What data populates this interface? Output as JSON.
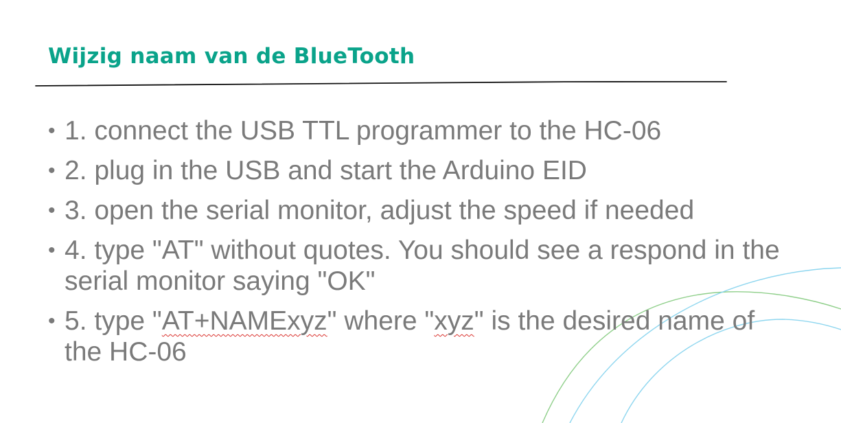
{
  "title": "Wijzig naam van de BlueTooth",
  "bullet_symbol": "•",
  "steps": [
    {
      "text": "1. connect the USB TTL programmer to the HC-06"
    },
    {
      "text": "2. plug in the USB and start the Arduino EID"
    },
    {
      "text": "3. open the serial monitor, adjust the speed if needed"
    },
    {
      "text": "4. type \"AT\" without quotes. You should see a respond in the serial monitor saying \"OK\""
    },
    {
      "p1": "5. type \"",
      "p2": "AT+NAMExyz",
      "p3": "\" where \"",
      "p4": "xyz",
      "p5": "\" is the desired name of the HC-06"
    }
  ],
  "colors": {
    "title": "#0aa38a",
    "body_text": "#7a7a7a",
    "rule": "#111111",
    "arc_green": "#8fcf8a",
    "arc_blue": "#8ed6ef",
    "spell_squiggle": "#d9302c"
  }
}
